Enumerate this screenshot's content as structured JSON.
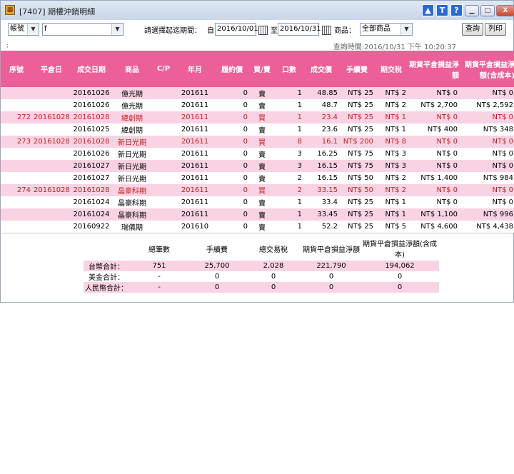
{
  "window": {
    "title": "[7407] 期權沖銷明細",
    "icons": [
      "upload-icon",
      "text-icon",
      "help-icon"
    ],
    "icon_glyphs": [
      "▲",
      "T",
      "?"
    ],
    "min_glyph": "▁",
    "max_glyph": "□",
    "close_glyph": "X"
  },
  "toolbar": {
    "account_select": "帳號",
    "account_name": "f",
    "prompt": "請選擇起迄期間：",
    "from_label": "自",
    "from_date": "2016/10/01",
    "to_label": "至",
    "to_date": "2016/10/31",
    "product_label": "商品：",
    "product_select": "全部商品",
    "query_button": "查詢",
    "print_button": "列印"
  },
  "semi": ";",
  "query_time": "查詢時間:2016/10/31 下午 10:20:37",
  "columns": [
    "序號",
    "平倉日",
    "成交日期",
    "商品",
    "C/P",
    "年月",
    "履約價",
    "買/賣",
    "口數",
    "成交價",
    "手續費",
    "期交稅",
    "期貨平倉損益淨額",
    "期貨平倉損益淨額(含成本)"
  ],
  "rows": [
    {
      "seq": "",
      "close_date": "",
      "trade_date": "20161026",
      "product": "億光期",
      "cp": "",
      "ym": "201611",
      "strike": "0",
      "bs": "賣",
      "qty": "1",
      "price": "48.85",
      "fee": "NT$ 25",
      "tax": "NT$ 2",
      "pnl": "NT$ 0",
      "pnl_cost": "NT$ 0",
      "red": false
    },
    {
      "seq": "",
      "close_date": "",
      "trade_date": "20161026",
      "product": "億光期",
      "cp": "",
      "ym": "201611",
      "strike": "0",
      "bs": "賣",
      "qty": "1",
      "price": "48.7",
      "fee": "NT$ 25",
      "tax": "NT$ 2",
      "pnl": "NT$ 2,700",
      "pnl_cost": "NT$ 2,592",
      "red": false
    },
    {
      "seq": "272",
      "close_date": "20161028",
      "trade_date": "20161028",
      "product": "緯創期",
      "cp": "",
      "ym": "201611",
      "strike": "0",
      "bs": "買",
      "qty": "1",
      "price": "23.4",
      "fee": "NT$ 25",
      "tax": "NT$ 1",
      "pnl": "NT$ 0",
      "pnl_cost": "NT$ 0",
      "red": true
    },
    {
      "seq": "",
      "close_date": "",
      "trade_date": "20161025",
      "product": "緯創期",
      "cp": "",
      "ym": "201611",
      "strike": "0",
      "bs": "賣",
      "qty": "1",
      "price": "23.6",
      "fee": "NT$ 25",
      "tax": "NT$ 1",
      "pnl": "NT$ 400",
      "pnl_cost": "NT$ 348",
      "red": false
    },
    {
      "seq": "273",
      "close_date": "20161028",
      "trade_date": "20161028",
      "product": "新日光期",
      "cp": "",
      "ym": "201611",
      "strike": "0",
      "bs": "買",
      "qty": "8",
      "price": "16.1",
      "fee": "NT$ 200",
      "tax": "NT$ 8",
      "pnl": "NT$ 0",
      "pnl_cost": "NT$ 0",
      "red": true
    },
    {
      "seq": "",
      "close_date": "",
      "trade_date": "20161026",
      "product": "新日光期",
      "cp": "",
      "ym": "201611",
      "strike": "0",
      "bs": "賣",
      "qty": "3",
      "price": "16.25",
      "fee": "NT$ 75",
      "tax": "NT$ 3",
      "pnl": "NT$ 0",
      "pnl_cost": "NT$ 0",
      "red": false
    },
    {
      "seq": "",
      "close_date": "",
      "trade_date": "20161027",
      "product": "新日光期",
      "cp": "",
      "ym": "201611",
      "strike": "0",
      "bs": "賣",
      "qty": "3",
      "price": "16.15",
      "fee": "NT$ 75",
      "tax": "NT$ 3",
      "pnl": "NT$ 0",
      "pnl_cost": "NT$ 0",
      "red": false
    },
    {
      "seq": "",
      "close_date": "",
      "trade_date": "20161027",
      "product": "新日光期",
      "cp": "",
      "ym": "201611",
      "strike": "0",
      "bs": "賣",
      "qty": "2",
      "price": "16.15",
      "fee": "NT$ 50",
      "tax": "NT$ 2",
      "pnl": "NT$ 1,400",
      "pnl_cost": "NT$ 984",
      "red": false
    },
    {
      "seq": "274",
      "close_date": "20161028",
      "trade_date": "20161028",
      "product": "晶豪科期",
      "cp": "",
      "ym": "201611",
      "strike": "0",
      "bs": "買",
      "qty": "2",
      "price": "33.15",
      "fee": "NT$ 50",
      "tax": "NT$ 2",
      "pnl": "NT$ 0",
      "pnl_cost": "NT$ 0",
      "red": true
    },
    {
      "seq": "",
      "close_date": "",
      "trade_date": "20161024",
      "product": "晶豪科期",
      "cp": "",
      "ym": "201611",
      "strike": "0",
      "bs": "賣",
      "qty": "1",
      "price": "33.4",
      "fee": "NT$ 25",
      "tax": "NT$ 1",
      "pnl": "NT$ 0",
      "pnl_cost": "NT$ 0",
      "red": false
    },
    {
      "seq": "",
      "close_date": "",
      "trade_date": "20161024",
      "product": "晶豪科期",
      "cp": "",
      "ym": "201611",
      "strike": "0",
      "bs": "賣",
      "qty": "1",
      "price": "33.45",
      "fee": "NT$ 25",
      "tax": "NT$ 1",
      "pnl": "NT$ 1,100",
      "pnl_cost": "NT$ 996",
      "red": false
    },
    {
      "seq": "",
      "close_date": "",
      "trade_date": "20160922",
      "product": "瑞儀期",
      "cp": "",
      "ym": "201610",
      "strike": "0",
      "bs": "賣",
      "qty": "1",
      "price": "52.2",
      "fee": "NT$ 25",
      "tax": "NT$ 5",
      "pnl": "NT$ 4,600",
      "pnl_cost": "NT$ 4,438",
      "red": false
    }
  ],
  "summary": {
    "headers": [
      "",
      "總筆數",
      "手續費",
      "總交易稅",
      "期貨平倉損益淨額",
      "期貨平倉損益淨額(含成本)"
    ],
    "rows": [
      {
        "label": "台幣合計：",
        "count": "751",
        "fee": "25,700",
        "tax": "2,028",
        "pnl": "221,790",
        "pnl_cost": "194,062"
      },
      {
        "label": "美金合計：",
        "count": "-",
        "fee": "0",
        "tax": "0",
        "pnl": "0",
        "pnl_cost": "0"
      },
      {
        "label": "人民幣合計：",
        "count": "-",
        "fee": "0",
        "tax": "0",
        "pnl": "0",
        "pnl_cost": "0"
      }
    ]
  },
  "colors": {
    "header": "#ec5f98",
    "row_pink": "#f9d3e3",
    "red_text": "#cc1b1b"
  }
}
